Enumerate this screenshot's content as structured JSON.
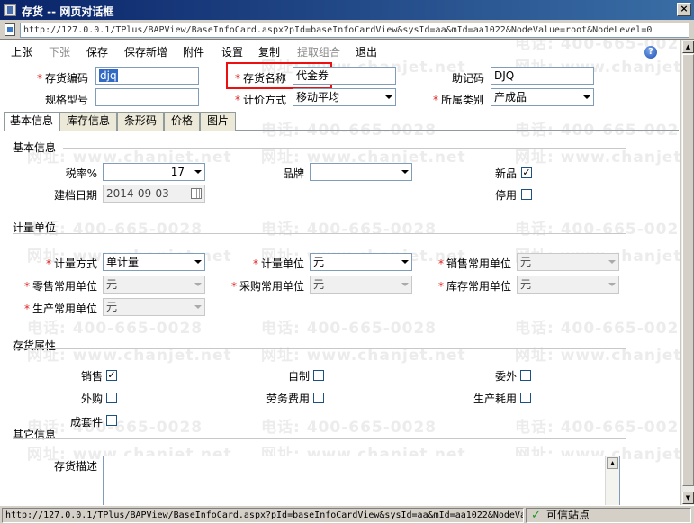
{
  "window": {
    "title": "存货 -- 网页对话框",
    "close_label": "×"
  },
  "address": {
    "url": "http://127.0.0.1/TPlus/BAPView/BaseInfoCard.aspx?pId=baseInfoCardView&sysId=aa&mId=aa1022&NodeValue=root&NodeLevel=0"
  },
  "toolbar": {
    "prev": "上张",
    "next": "下张",
    "save": "保存",
    "save_new": "保存新增",
    "attach": "附件",
    "settings": "设置",
    "copy": "复制",
    "extract": "提取组合",
    "exit": "退出",
    "help": "?"
  },
  "header": {
    "code_label": "存货编码",
    "code_value": "djq",
    "name_label": "存货名称",
    "name_value": "代金券",
    "mnemonic_label": "助记码",
    "mnemonic_value": "DJQ",
    "spec_label": "规格型号",
    "spec_value": "",
    "pricing_label": "计价方式",
    "pricing_value": "移动平均",
    "category_label": "所属类别",
    "category_value": "产成品"
  },
  "tabs": [
    "基本信息",
    "库存信息",
    "条形码",
    "价格",
    "图片"
  ],
  "basic": {
    "section_title": "基本信息",
    "tax_label": "税率%",
    "tax_value": "17",
    "brand_label": "品牌",
    "brand_value": "",
    "new_label": "新品",
    "new_checked": "✓",
    "date_label": "建档日期",
    "date_value": "2014-09-03",
    "disabled_label": "停用",
    "disabled_checked": ""
  },
  "unit": {
    "section_title": "计量单位",
    "method_label": "计量方式",
    "method_value": "单计量",
    "unit_label": "计量单位",
    "unit_value": "元",
    "sales_label": "销售常用单位",
    "sales_value": "元",
    "retail_label": "零售常用单位",
    "retail_value": "元",
    "purchase_label": "采购常用单位",
    "purchase_value": "元",
    "stock_label": "库存常用单位",
    "stock_value": "元",
    "production_label": "生产常用单位",
    "production_value": "元"
  },
  "attrs": {
    "section_title": "存货属性",
    "sales_label": "销售",
    "sales_checked": "✓",
    "selfmade_label": "自制",
    "selfmade_checked": "",
    "outsource_label": "委外",
    "outsource_checked": "",
    "purchased_label": "外购",
    "purchased_checked": "",
    "labor_label": "劳务费用",
    "labor_checked": "",
    "consume_label": "生产耗用",
    "consume_checked": "",
    "kit_label": "成套件",
    "kit_checked": ""
  },
  "other": {
    "section_title": "其它信息",
    "desc_label": "存货描述",
    "desc_value": ""
  },
  "watermark": {
    "phone": "电话: 400-665-0028",
    "site": "网址: www.chanjet.net"
  },
  "status": {
    "url": "http://127.0.0.1/TPlus/BAPView/BaseInfoCard.aspx?pId=baseInfoCardView&sysId=aa&mId=aa1022&NodeValue=root&NodeLevel=0",
    "zone": "可信站点"
  },
  "colors": {
    "title_bar": "#0a246a",
    "required_star": "#e02020",
    "highlight_box": "#ee1010",
    "selection": "#316ac5"
  }
}
